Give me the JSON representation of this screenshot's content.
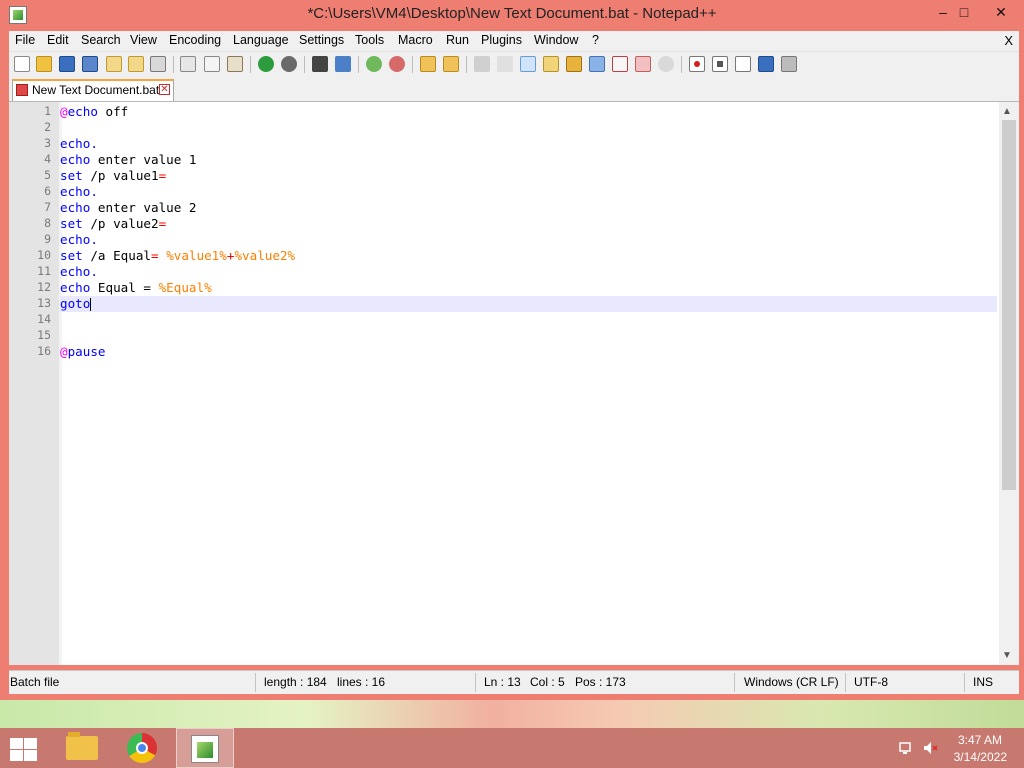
{
  "window": {
    "title": "*C:\\Users\\VM4\\Desktop\\New Text Document.bat - Notepad++",
    "controls": {
      "minimize": "–",
      "maximize": "□",
      "close": "✕"
    }
  },
  "menu": {
    "items": [
      "File",
      "Edit",
      "Search",
      "View",
      "Encoding",
      "Language",
      "Settings",
      "Tools",
      "Macro",
      "Run",
      "Plugins",
      "Window",
      "?"
    ],
    "close": "X"
  },
  "toolbar": {
    "icons": [
      "new-file-icon",
      "open-file-icon",
      "save-icon",
      "save-all-icon",
      "close-icon",
      "close-all-icon",
      "print-icon",
      "cut-icon",
      "copy-icon",
      "paste-icon",
      "undo-icon",
      "redo-icon",
      "find-icon",
      "replace-icon",
      "zoom-in-icon",
      "zoom-out-icon",
      "sync-vertical-icon",
      "sync-horizontal-icon",
      "word-wrap-icon",
      "show-all-characters-icon",
      "indent-guide-icon",
      "user-defined-language-icon",
      "doc-map-icon",
      "function-list-icon",
      "folder-as-workspace-icon",
      "doc-switcher-icon",
      "monitoring-icon",
      "record-macro-icon",
      "stop-recording-icon",
      "playback-macro-icon",
      "run-macro-multiple-icon",
      "save-macro-icon"
    ]
  },
  "tab": {
    "label": "New Text Document.bat",
    "close": "✕"
  },
  "editor": {
    "current_line": 13,
    "lines": [
      [
        {
          "t": "@",
          "c": "at"
        },
        {
          "t": "echo",
          "c": "kw"
        },
        {
          "t": " off",
          "c": "plain"
        }
      ],
      [],
      [
        {
          "t": "echo.",
          "c": "kw"
        }
      ],
      [
        {
          "t": "echo",
          "c": "kw"
        },
        {
          "t": " enter value 1",
          "c": "plain"
        }
      ],
      [
        {
          "t": "set",
          "c": "kw"
        },
        {
          "t": " /p value1",
          "c": "plain"
        },
        {
          "t": "=",
          "c": "op"
        }
      ],
      [
        {
          "t": "echo.",
          "c": "kw"
        }
      ],
      [
        {
          "t": "echo",
          "c": "kw"
        },
        {
          "t": " enter value 2",
          "c": "plain"
        }
      ],
      [
        {
          "t": "set",
          "c": "kw"
        },
        {
          "t": " /p value2",
          "c": "plain"
        },
        {
          "t": "=",
          "c": "op"
        }
      ],
      [
        {
          "t": "echo.",
          "c": "kw"
        }
      ],
      [
        {
          "t": "set",
          "c": "kw"
        },
        {
          "t": " /a Equal",
          "c": "plain"
        },
        {
          "t": "=",
          "c": "op"
        },
        {
          "t": " ",
          "c": "plain"
        },
        {
          "t": "%value1%",
          "c": "var"
        },
        {
          "t": "+",
          "c": "op"
        },
        {
          "t": "%value2%",
          "c": "var"
        }
      ],
      [
        {
          "t": "echo.",
          "c": "kw"
        }
      ],
      [
        {
          "t": "echo",
          "c": "kw"
        },
        {
          "t": " Equal = ",
          "c": "plain"
        },
        {
          "t": "%Equal%",
          "c": "var"
        }
      ],
      [
        {
          "t": "goto",
          "c": "kw"
        }
      ],
      [],
      [],
      [
        {
          "t": "@",
          "c": "at"
        },
        {
          "t": "pause",
          "c": "kw"
        }
      ]
    ]
  },
  "status": {
    "filetype": "Batch file",
    "length": "length : 184",
    "lines": "lines : 16",
    "ln": "Ln : 13",
    "col": "Col : 5",
    "pos": "Pos : 173",
    "eol": "Windows (CR LF)",
    "encoding": "UTF-8",
    "mode": "INS"
  },
  "taskbar": {
    "apps": [
      "file-explorer-icon",
      "chrome-icon",
      "notepad-plus-plus-icon"
    ],
    "clock": {
      "time": "3:47 AM",
      "date": "3/14/2022"
    }
  },
  "colors": {
    "titlebar": "#ef7e72",
    "keyword": "#0000ff",
    "operator": "#ff0000",
    "at_sign": "#ff00ff",
    "variable": "#ff8000",
    "current_line": "#e8e8ff",
    "taskbar": "#c77970"
  }
}
